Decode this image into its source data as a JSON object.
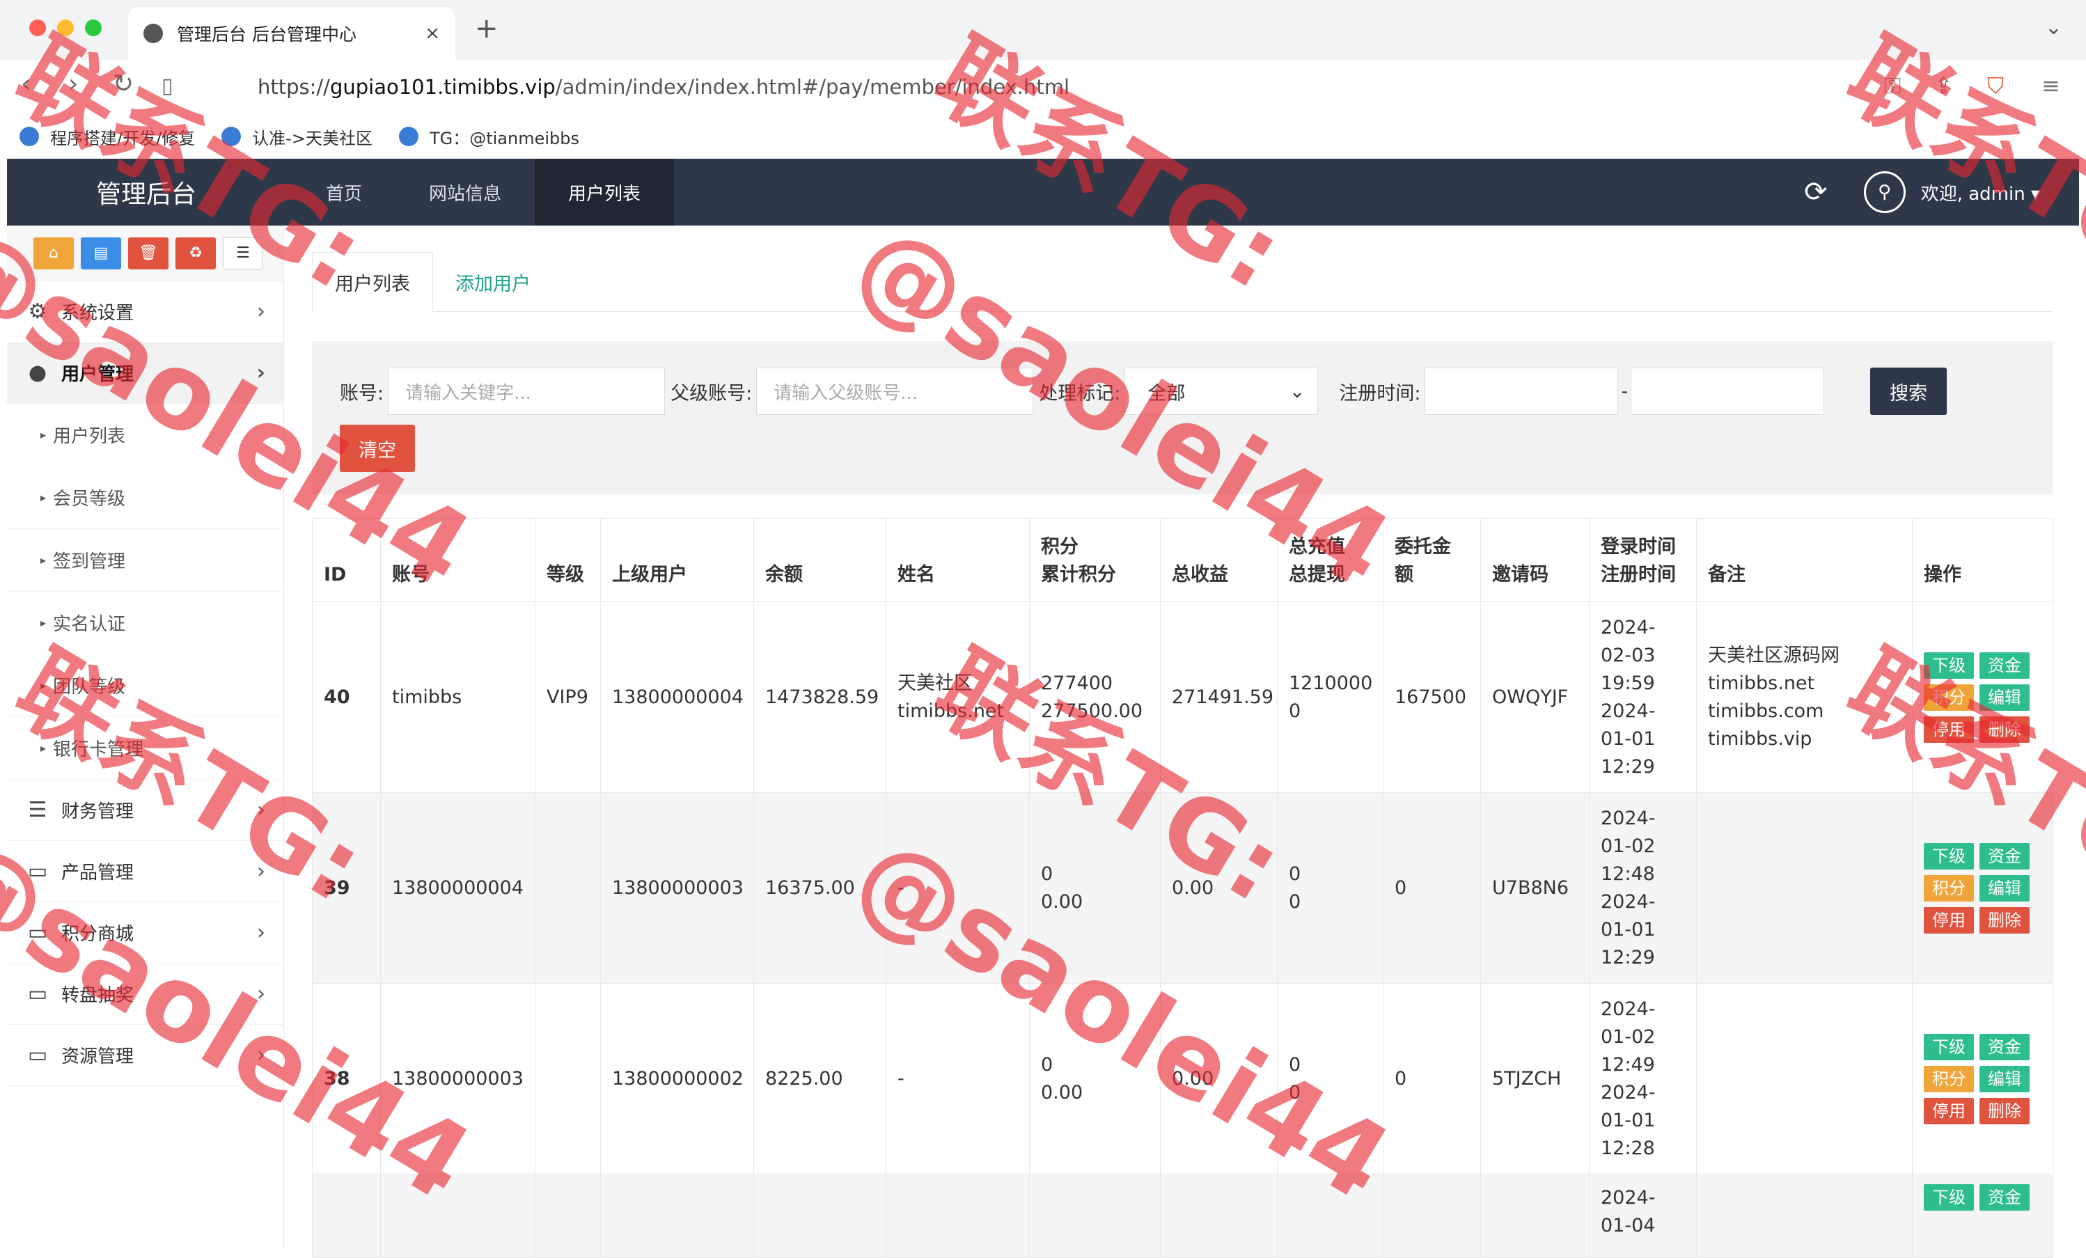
{
  "browser": {
    "tab_title": "管理后台 后台管理中心",
    "close_glyph": "×",
    "new_tab": "+",
    "url_scheme": "https://",
    "url_host": "gupiao101.timibbs.vip",
    "url_path": "/admin/index/index.html#/pay/member/index.html",
    "bookmarks": [
      "程序搭建/开发/修复",
      "认准->天美社区",
      "TG：@tianmeibbs"
    ]
  },
  "header": {
    "brand": "管理后台",
    "nav": [
      "首页",
      "网站信息",
      "用户列表"
    ],
    "active_nav": "用户列表",
    "user": "欢迎, admin ▾"
  },
  "sidebar": {
    "quick_buttons": [
      {
        "icon": "home-icon",
        "color": "#f0a53a"
      },
      {
        "icon": "file-icon",
        "color": "#3a8ee6"
      },
      {
        "icon": "trash-icon",
        "color": "#e0533f"
      },
      {
        "icon": "recycle-icon",
        "color": "#e0533f"
      },
      {
        "icon": "list-icon",
        "color": "#ffffff"
      }
    ],
    "menu": [
      {
        "label": "系统设置",
        "icon": "gears-icon"
      },
      {
        "label": "用户管理",
        "icon": "user-icon",
        "open": true,
        "children": [
          "用户列表",
          "会员等级",
          "签到管理",
          "实名认证",
          "团队等级",
          "银行卡管理"
        ]
      },
      {
        "label": "财务管理",
        "icon": "database-icon"
      },
      {
        "label": "产品管理",
        "icon": "monitor-icon"
      },
      {
        "label": "积分商城",
        "icon": "monitor-icon"
      },
      {
        "label": "转盘抽奖",
        "icon": "monitor-icon"
      },
      {
        "label": "资源管理",
        "icon": "monitor-icon"
      }
    ]
  },
  "main": {
    "tabs": [
      "用户列表",
      "添加用户"
    ],
    "filter": {
      "account_label": "账号:",
      "account_placeholder": "请输入关键字...",
      "parent_label": "父级账号:",
      "parent_placeholder": "请输入父级账号...",
      "mark_label": "处理标记:",
      "mark_value": "全部",
      "reg_time_label": "注册时间:",
      "range_sep": "-",
      "search": "搜索",
      "clear": "清空"
    },
    "table": {
      "headers": [
        "ID",
        "账号",
        "等级",
        "上级用户",
        "余额",
        "姓名",
        "积分\n累计积分",
        "总收益",
        "总充值\n总提现",
        "委托金\n额",
        "邀请码",
        "登录时间\n注册时间",
        "备注",
        "操作"
      ],
      "rows": [
        {
          "id": "40",
          "account": "timibbs",
          "level": "VIP9",
          "parent": "13800000004",
          "balance": "1473828.59",
          "name": "天美社区\ntimibbs.net",
          "points": "277400\n277500.00",
          "income": "271491.59",
          "recharge": "1210000\n0",
          "entrust": "167500",
          "invite": "OWQYJF",
          "time": "2024-\n02-03\n19:59\n2024-\n01-01\n12:29",
          "remark": "天美社区源码网\ntimibbs.net\ntimibbs.com\ntimibbs.vip"
        },
        {
          "id": "39",
          "account": "13800000004",
          "level": "",
          "parent": "13800000003",
          "balance": "16375.00",
          "name": "-",
          "points": "0\n0.00",
          "income": "0.00",
          "recharge": "0\n0",
          "entrust": "0",
          "invite": "U7B8N6",
          "time": "2024-\n01-02\n12:48\n2024-\n01-01\n12:29",
          "remark": ""
        },
        {
          "id": "38",
          "account": "13800000003",
          "level": "",
          "parent": "13800000002",
          "balance": "8225.00",
          "name": "-",
          "points": "0\n0.00",
          "income": "0.00",
          "recharge": "0\n0",
          "entrust": "0",
          "invite": "5TJZCH",
          "time": "2024-\n01-02\n12:49\n2024-\n01-01\n12:28",
          "remark": ""
        },
        {
          "id": "",
          "account": "",
          "level": "",
          "parent": "",
          "balance": "",
          "name": "",
          "points": "",
          "income": "",
          "recharge": "",
          "entrust": "",
          "invite": "",
          "time": "2024-\n01-04",
          "remark": ""
        }
      ],
      "ops": [
        "下级",
        "资金",
        "积分",
        "编辑",
        "停用",
        "删除"
      ]
    }
  },
  "watermark": {
    "line1": "联系TG:",
    "line2": "@saolei44",
    "color": "#e62832"
  }
}
